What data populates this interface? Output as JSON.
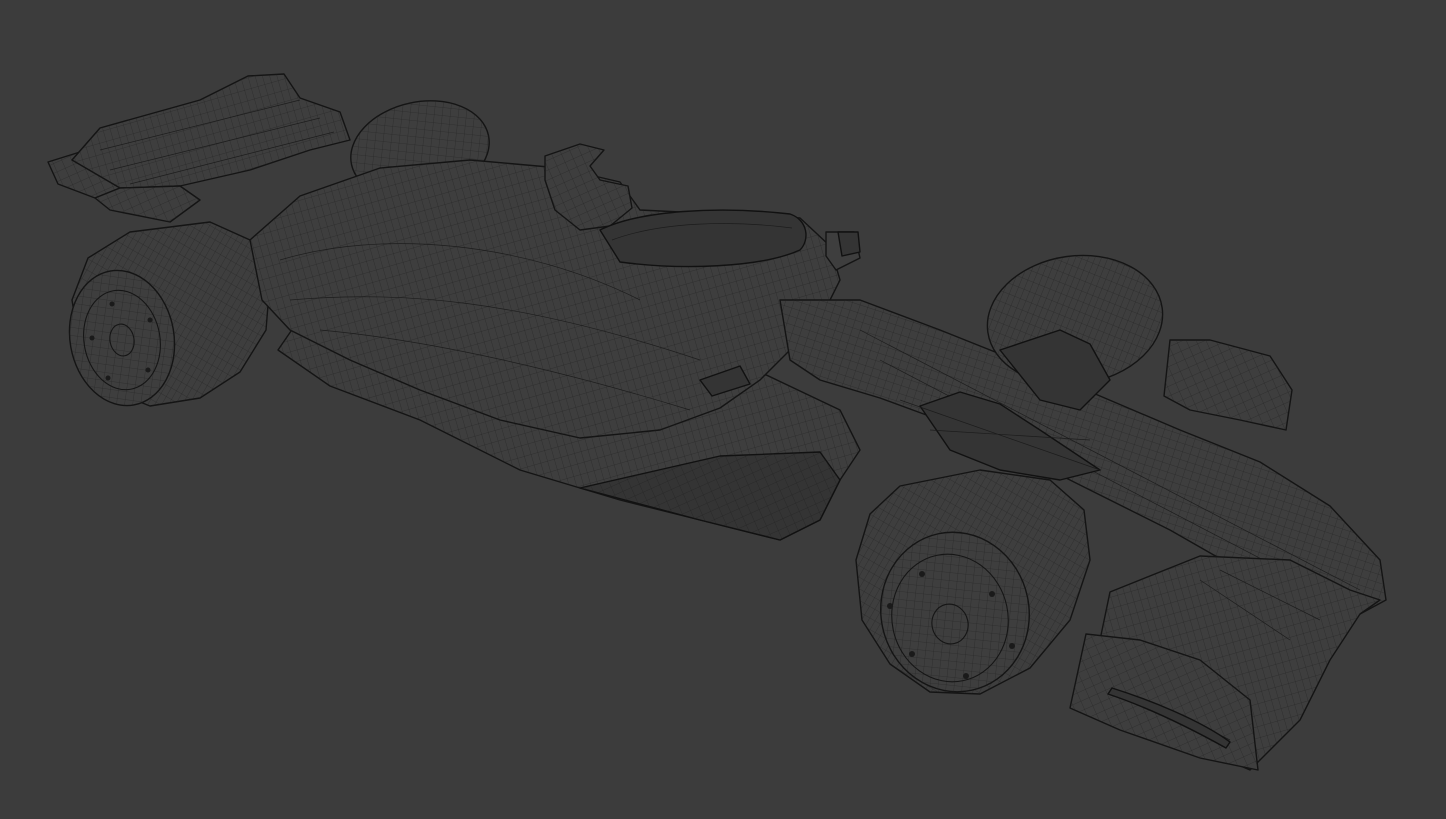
{
  "viewport": {
    "background": "#3c3c3c",
    "wire_color": "#1c1c1c",
    "shading": "wireframe"
  },
  "model": {
    "subject": "formula-car-mesh"
  }
}
